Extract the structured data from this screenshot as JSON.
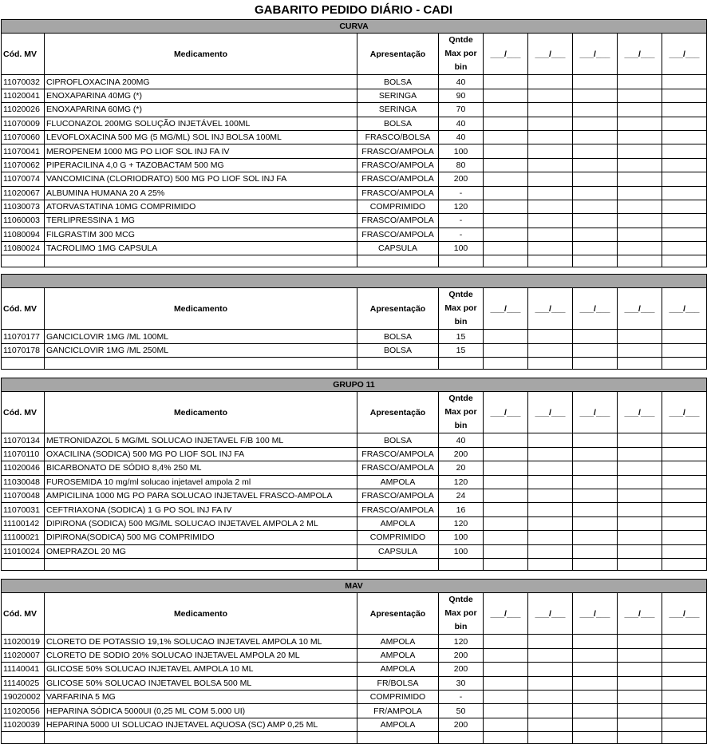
{
  "title": "GABARITO PEDIDO DIÁRIO - CADI",
  "header": {
    "cod": "Cód. MV",
    "med": "Medicamento",
    "apr": "Apresentação",
    "qt": "Qntde Max por bin",
    "date": "___/___"
  },
  "sections": [
    {
      "name": "CURVA",
      "rows": [
        [
          "11070032",
          "CIPROFLOXACINA 200MG",
          "BOLSA",
          "40"
        ],
        [
          "11020041",
          "ENOXAPARINA 40MG (*)",
          "SERINGA",
          "90"
        ],
        [
          "11020026",
          "ENOXAPARINA 60MG (*)",
          "SERINGA",
          "70"
        ],
        [
          "11070009",
          "FLUCONAZOL 200MG SOLUÇÃO INJETÁVEL 100ML",
          "BOLSA",
          "40"
        ],
        [
          "11070060",
          "LEVOFLOXACINA 500 MG (5 MG/ML) SOL INJ BOLSA 100ML",
          "FRASCO/BOLSA",
          "40"
        ],
        [
          "11070041",
          "MEROPENEM 1000 MG PO LIOF SOL INJ FA IV",
          "FRASCO/AMPOLA",
          "100"
        ],
        [
          "11070062",
          "PIPERACILINA 4,0 G + TAZOBACTAM 500 MG",
          "FRASCO/AMPOLA",
          "80"
        ],
        [
          "11070074",
          "VANCOMICINA (CLORIODRATO) 500 MG PO LIOF SOL INJ FA",
          "FRASCO/AMPOLA",
          "200"
        ],
        [
          "11020067",
          "ALBUMINA HUMANA 20 A 25%",
          "FRASCO/AMPOLA",
          "-"
        ],
        [
          "11030073",
          "ATORVASTATINA 10MG COMPRIMIDO",
          "COMPRIMIDO",
          "120"
        ],
        [
          "11060003",
          "TERLIPRESSINA 1 MG",
          "FRASCO/AMPOLA",
          "-"
        ],
        [
          "11080094",
          "FILGRASTIM 300 MCG",
          "FRASCO/AMPOLA",
          "-"
        ],
        [
          "11080024",
          "TACROLIMO 1MG CAPSULA",
          "CAPSULA",
          "100"
        ]
      ]
    },
    {
      "name": "",
      "rows": [
        [
          "11070177",
          "GANCICLOVIR 1MG /ML 100ML",
          "BOLSA",
          "15"
        ],
        [
          "11070178",
          "GANCICLOVIR 1MG /ML 250ML",
          "BOLSA",
          "15"
        ]
      ]
    },
    {
      "name": "GRUPO 11",
      "rows": [
        [
          "11070134",
          "METRONIDAZOL 5 MG/ML SOLUCAO INJETAVEL F/B 100 ML",
          "BOLSA",
          "40"
        ],
        [
          "11070110",
          "OXACILINA (SODICA) 500 MG PO LIOF SOL INJ FA",
          "FRASCO/AMPOLA",
          "200"
        ],
        [
          "11020046",
          "BICARBONATO DE SÓDIO 8,4% 250 ML",
          "FRASCO/AMPOLA",
          "20"
        ],
        [
          "11030048",
          "FUROSEMIDA 10 mg/ml solucao injetavel ampola 2 ml",
          "AMPOLA",
          "120"
        ],
        [
          "11070048",
          "AMPICILINA 1000 MG PO PARA SOLUCAO INJETAVEL FRASCO-AMPOLA",
          "FRASCO/AMPOLA",
          "24"
        ],
        [
          "11070031",
          "CEFTRIAXONA (SODICA) 1 G PO SOL INJ FA IV",
          "FRASCO/AMPOLA",
          "16"
        ],
        [
          "11100142",
          "DIPIRONA (SODICA) 500 MG/ML SOLUCAO INJETAVEL AMPOLA 2 ML",
          "AMPOLA",
          "120"
        ],
        [
          "11100021",
          "DIPIRONA(SODICA) 500 MG COMPRIMIDO",
          "COMPRIMIDO",
          "100"
        ],
        [
          "11010024",
          "OMEPRAZOL 20 MG",
          "CAPSULA",
          "100"
        ]
      ]
    },
    {
      "name": "MAV",
      "rows": [
        [
          "11020019",
          "CLORETO DE POTASSIO 19,1% SOLUCAO INJETAVEL AMPOLA 10 ML",
          "AMPOLA",
          "120"
        ],
        [
          "11020007",
          "CLORETO DE SODIO 20% SOLUCAO INJETAVEL AMPOLA 20 ML",
          "AMPOLA",
          "200"
        ],
        [
          "11140041",
          "GLICOSE 50% SOLUCAO INJETAVEL AMPOLA 10 ML",
          "AMPOLA",
          "200"
        ],
        [
          "11140025",
          "GLICOSE 50% SOLUCAO INJETAVEL BOLSA 500 ML",
          "FR/BOLSA",
          "30"
        ],
        [
          "19020002",
          "VARFARINA 5 MG",
          "COMPRIMIDO",
          "-"
        ],
        [
          "11020056",
          "HEPARINA SÓDICA 5000UI (0,25 ML COM 5.000 UI)",
          "FR/AMPOLA",
          "50"
        ],
        [
          "11020039",
          "HEPARINA 5000 UI SOLUCAO INJETAVEL AQUOSA (SC) AMP 0,25 ML",
          "AMPOLA",
          "200"
        ]
      ]
    }
  ]
}
